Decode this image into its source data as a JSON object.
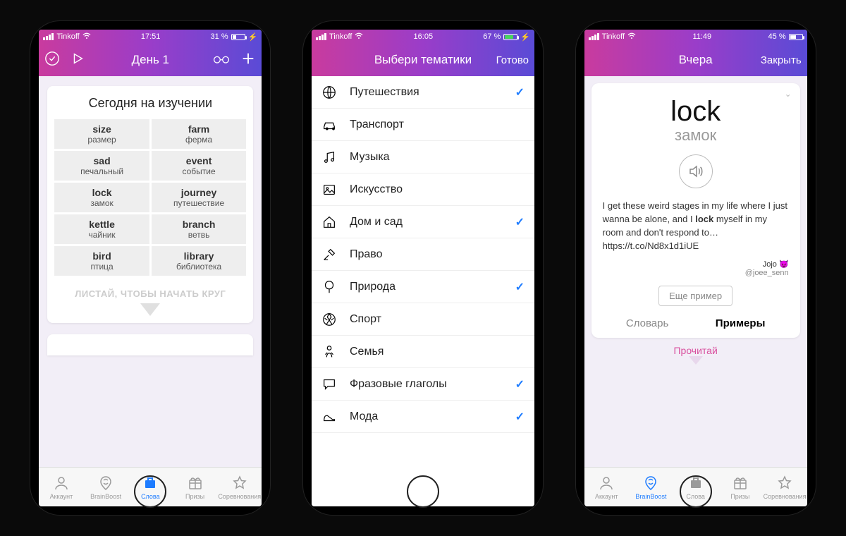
{
  "screens": [
    {
      "status": {
        "carrier": "Tinkoff",
        "time": "17:51",
        "battery_pct": "31 %",
        "battery_fill": 31,
        "charging": true
      },
      "nav": {
        "title": "День 1"
      },
      "card": {
        "title": "Сегодня на изучении",
        "words": [
          {
            "en": "size",
            "ru": "размер"
          },
          {
            "en": "farm",
            "ru": "ферма"
          },
          {
            "en": "sad",
            "ru": "печальный"
          },
          {
            "en": "event",
            "ru": "событие"
          },
          {
            "en": "lock",
            "ru": "замок"
          },
          {
            "en": "journey",
            "ru": "путешествие"
          },
          {
            "en": "kettle",
            "ru": "чайник"
          },
          {
            "en": "branch",
            "ru": "ветвь"
          },
          {
            "en": "bird",
            "ru": "птица"
          },
          {
            "en": "library",
            "ru": "библиотека"
          }
        ],
        "hint": "ЛИСТАЙ, ЧТОБЫ НАЧАТЬ КРУГ"
      },
      "tabs": [
        {
          "label": "Аккаунт"
        },
        {
          "label": "BrainBoost"
        },
        {
          "label": "Слова",
          "active": true
        },
        {
          "label": "Призы"
        },
        {
          "label": "Соревнования"
        }
      ]
    },
    {
      "status": {
        "carrier": "Tinkoff",
        "time": "16:05",
        "battery_pct": "67 %",
        "battery_fill": 67,
        "charging": true,
        "green": true
      },
      "nav": {
        "title": "Выбери тематики",
        "done": "Готово"
      },
      "topics": [
        {
          "label": "Путешествия",
          "checked": true,
          "icon": "globe"
        },
        {
          "label": "Транспорт",
          "checked": false,
          "icon": "car"
        },
        {
          "label": "Музыка",
          "checked": false,
          "icon": "music"
        },
        {
          "label": "Искусство",
          "checked": false,
          "icon": "image"
        },
        {
          "label": "Дом и сад",
          "checked": true,
          "icon": "home"
        },
        {
          "label": "Право",
          "checked": false,
          "icon": "gavel"
        },
        {
          "label": "Природа",
          "checked": true,
          "icon": "tree"
        },
        {
          "label": "Спорт",
          "checked": false,
          "icon": "ball"
        },
        {
          "label": "Семья",
          "checked": false,
          "icon": "family"
        },
        {
          "label": "Фразовые глаголы",
          "checked": true,
          "icon": "chat"
        },
        {
          "label": "Мода",
          "checked": true,
          "icon": "shoe"
        }
      ]
    },
    {
      "status": {
        "carrier": "Tinkoff",
        "time": "11:49",
        "battery_pct": "45 %",
        "battery_fill": 45,
        "charging": false
      },
      "nav": {
        "title": "Вчера",
        "close": "Закрыть"
      },
      "word": {
        "en": "lock",
        "ru": "замок"
      },
      "example": {
        "text_pre": "I get these weird stages in my life where I just wanna be alone, and I ",
        "bold": "lock",
        "text_post": " myself in my room and don't respond to… https://t.co/Nd8x1d1iUE",
        "author": "Jojo 😈",
        "handle": "@joee_senn"
      },
      "more_btn": "Еще пример",
      "segtabs": [
        {
          "label": "Словарь"
        },
        {
          "label": "Примеры",
          "active": true
        }
      ],
      "read_hint": "Прочитай",
      "tabs": [
        {
          "label": "Аккаунт"
        },
        {
          "label": "BrainBoost",
          "active": true
        },
        {
          "label": "Слова"
        },
        {
          "label": "Призы"
        },
        {
          "label": "Соревнования"
        }
      ]
    }
  ]
}
